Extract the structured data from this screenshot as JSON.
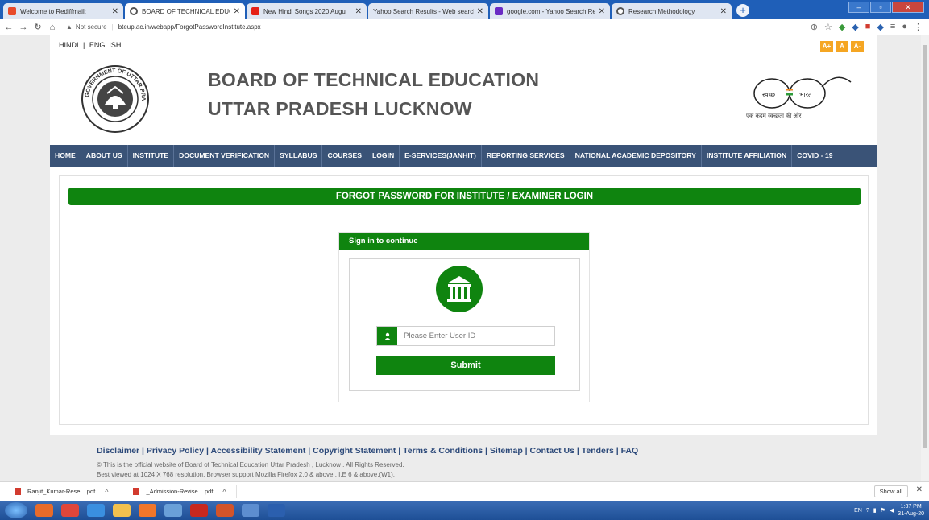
{
  "browser": {
    "tabs": [
      {
        "title": "Welcome to Rediffmail:",
        "fav": "#e84b2c",
        "active": false
      },
      {
        "title": "BOARD OF TECHNICAL EDUCATI",
        "fav": "#555555",
        "active": true
      },
      {
        "title": "New Hindi Songs 2020 Augu",
        "fav": "#e62117",
        "active": false
      },
      {
        "title": "Yahoo Search Results - Web search",
        "fav": "#ffffff",
        "active": false
      },
      {
        "title": "google.com - Yahoo Search Resu",
        "fav": "#6a2bc4",
        "active": false
      },
      {
        "title": "Research Methodology",
        "fav": "#555555",
        "active": false
      }
    ],
    "new_tab": "+",
    "security": "Not secure",
    "url": "bteup.ac.in/webapp/ForgotPasswordInstitute.aspx"
  },
  "lang": {
    "hindi": "HINDI",
    "english": "ENGLISH",
    "separator": "|"
  },
  "font_buttons": [
    "A+",
    "A",
    "A-"
  ],
  "header": {
    "title_line1": "BOARD OF TECHNICAL EDUCATION",
    "title_line2": "UTTAR PRADESH LUCKNOW",
    "emblem_text": "GOVERNMENT OF UTTAR PRADESH",
    "swachh_left": "स्वच्छ",
    "swachh_right": "भारत",
    "swachh_tagline": "एक कदम स्वच्छता की ओर"
  },
  "nav": [
    "HOME",
    "ABOUT US",
    "INSTITUTE",
    "DOCUMENT VERIFICATION",
    "SYLLABUS",
    "COURSES",
    "LOGIN",
    "E-SERVICES(JANHIT)",
    "REPORTING SERVICES",
    "NATIONAL ACADEMIC DEPOSITORY",
    "INSTITUTE AFFILIATION",
    "COVID - 19"
  ],
  "banner": "FORGOT PASSWORD FOR INSTITUTE / EXAMINER LOGIN",
  "login": {
    "heading": "Sign in to continue",
    "user_placeholder": "Please Enter User ID",
    "submit": "Submit"
  },
  "footer": {
    "links": "Disclaimer | Privacy Policy | Accessibility Statement | Copyright Statement | Terms & Conditions | Sitemap | Contact Us | Tenders | FAQ",
    "note1": "© This is the official website of Board of Technical Education Uttar Pradesh , Lucknow . All Rights Reserved.",
    "note2": "Best viewed at 1024 X 768 resolution. Browser support Mozilla Firefox 2.0 & above , I.E 6 & above.(W1)."
  },
  "downloads": {
    "items": [
      "Ranjit_Kumar-Rese....pdf",
      "_Admission-Revise....pdf"
    ],
    "show_all": "Show all"
  },
  "taskbar": {
    "lang": "EN",
    "time": "1:37 PM",
    "date": "31-Aug-20"
  }
}
